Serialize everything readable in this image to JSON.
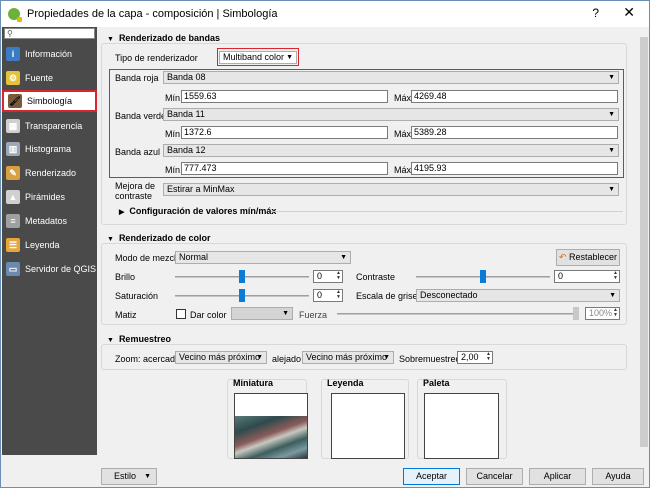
{
  "window": {
    "title": "Propiedades de la capa - composición | Simbología",
    "help": "?",
    "close": "✕"
  },
  "sidebar": {
    "search_placeholder": "",
    "items": [
      {
        "label": "Información",
        "icon": "info-icon",
        "color": "#3a7cc4",
        "glyph": "i"
      },
      {
        "label": "Fuente",
        "icon": "source-icon",
        "color": "#e6c23a",
        "glyph": "⚙"
      },
      {
        "label": "Simbología",
        "icon": "paintbrush-icon",
        "color": "#7a5a3a",
        "glyph": "🖌"
      },
      {
        "label": "Transparencia",
        "icon": "transparency-icon",
        "color": "#cfcfcf",
        "glyph": "▦"
      },
      {
        "label": "Histograma",
        "icon": "histogram-icon",
        "color": "#9aa8b8",
        "glyph": "▥"
      },
      {
        "label": "Renderizado",
        "icon": "render-icon",
        "color": "#d8a040",
        "glyph": "✎"
      },
      {
        "label": "Pirámides",
        "icon": "pyramid-icon",
        "color": "#d0d0d0",
        "glyph": "▲"
      },
      {
        "label": "Metadatos",
        "icon": "metadata-icon",
        "color": "#a0a0a0",
        "glyph": "≡"
      },
      {
        "label": "Leyenda",
        "icon": "legend-icon",
        "color": "#e8a63a",
        "glyph": "☰"
      },
      {
        "label": "Servidor de QGIS",
        "icon": "server-icon",
        "color": "#6a8ab0",
        "glyph": "▭"
      }
    ]
  },
  "bands": {
    "section": "Renderizado de bandas",
    "renderer_label": "Tipo de renderizador",
    "renderer_value": "Multiband color",
    "red": {
      "label": "Banda roja",
      "band": "Banda 08",
      "min_label": "Mín",
      "min": "1559.63",
      "max_label": "Máx",
      "max": "4269.48"
    },
    "green": {
      "label": "Banda verde",
      "band": "Banda 11",
      "min_label": "Mín",
      "min": "1372.6",
      "max_label": "Máx",
      "max": "5389.28"
    },
    "blue": {
      "label": "Banda azul",
      "band": "Banda 12",
      "min_label": "Mín",
      "min": "777.473",
      "max_label": "Máx",
      "max": "4195.93"
    },
    "enhance_label_1": "Mejora de",
    "enhance_label_2": "contraste",
    "enhance_value": "Estirar a MinMax",
    "minmax_section": "Configuración de valores mín/máx"
  },
  "color": {
    "section": "Renderizado de color",
    "blend_label": "Modo de mezcla",
    "blend_value": "Normal",
    "reset_label": "Restablecer",
    "brightness_label": "Brillo",
    "brightness_value": "0",
    "contrast_label": "Contraste",
    "contrast_value": "0",
    "saturation_label": "Saturación",
    "saturation_value": "0",
    "grayscale_label": "Escala de grises",
    "grayscale_value": "Desconectado",
    "hue_label": "Matiz",
    "colorize_label": "Dar color",
    "strength_label": "Fuerza",
    "strength_value": "100%"
  },
  "resample": {
    "section": "Remuestreo",
    "zoom_in_label": "Zoom: acercado",
    "zoom_in_value": "Vecino más próximo",
    "zoom_out_label": "alejado",
    "zoom_out_value": "Vecino más próximo",
    "oversample_label": "Sobremuestreo",
    "oversample_value": "2,00"
  },
  "previews": {
    "thumbnail": "Miniatura",
    "legend": "Leyenda",
    "palette": "Paleta"
  },
  "footer": {
    "style": "Estilo",
    "accept": "Aceptar",
    "cancel": "Cancelar",
    "apply": "Aplicar",
    "help": "Ayuda"
  }
}
